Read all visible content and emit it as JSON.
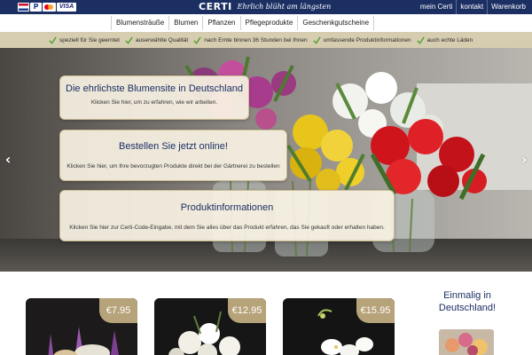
{
  "topbar": {
    "payment_icons": [
      "uk-flag-icon",
      "paypal-icon",
      "mastercard-icon",
      "visa-icon"
    ],
    "paypal_glyph": "P",
    "visa_label": "VISA",
    "logo": {
      "mark": "CERTI",
      "tagline": "Ehrlich blüht am längsten"
    },
    "links": [
      "mein Certi",
      "kontakt",
      "Warenkorb"
    ],
    "cart_icon": "cart-icon"
  },
  "nav": {
    "items": [
      "Blumensträuße",
      "Blumen",
      "Pflanzen",
      "Pflegeprodukte",
      "Geschenkgutscheine"
    ]
  },
  "features": [
    "speziell für Sie geerntet",
    "auserwählte Qualität",
    "nach Ernte binnen 36 Stunden bei Ihnen",
    "umfassende Produktinformationen",
    "auch echte Läden"
  ],
  "hero": {
    "panels": [
      {
        "title": "Die ehrlichste Blumensite in Deutschland",
        "subtitle": "Klicken Sie hier, um zu erfahren, wie wir arbeiten."
      },
      {
        "title": "Bestellen Sie jetzt online!",
        "subtitle": "Klicken Sie hier, um Ihre bevorzugten Produkte direkt bei der Gärtnerei zu bestellen"
      },
      {
        "title": "Produktinformationen",
        "subtitle": "Klicken Sie hier zur Certi-Code-Eingabe, mit dem Sie alles über das Produkt erfahren, das Sie gekauft oder erhalten haben."
      }
    ],
    "arrow_left": "‹",
    "arrow_right": "›"
  },
  "products": [
    {
      "price": "€7.95"
    },
    {
      "price": "€12.95"
    },
    {
      "price": "€15.95"
    }
  ],
  "promo": {
    "line1": "Einmalig in",
    "line2": "Deutschland!"
  },
  "colors": {
    "navy": "#1b2f63",
    "sand": "#d6cdb0",
    "price_badge": "#b7a37a",
    "check_green": "#5aa63a"
  }
}
